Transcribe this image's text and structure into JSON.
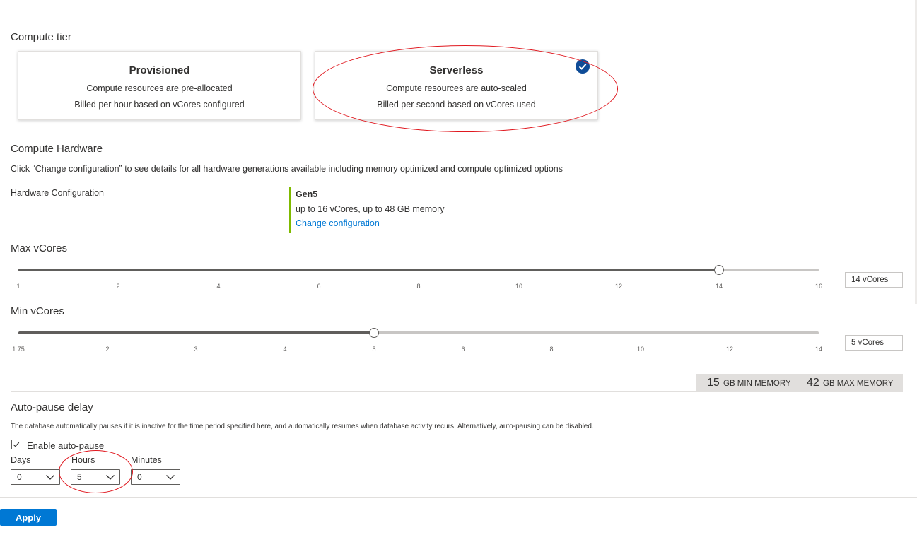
{
  "compute_tier": {
    "title": "Compute tier",
    "provisioned": {
      "title": "Provisioned",
      "line1": "Compute resources are pre-allocated",
      "line2": "Billed per hour based on vCores configured"
    },
    "serverless": {
      "title": "Serverless",
      "line1": "Compute resources are auto-scaled",
      "line2": "Billed per second based on vCores used",
      "selected": true
    }
  },
  "compute_hardware": {
    "title": "Compute Hardware",
    "description": "Click “Change configuration” to see details for all hardware generations available including memory optimized and compute optimized options",
    "config_label": "Hardware Configuration",
    "generation": "Gen5",
    "spec": "up to 16 vCores, up to 48 GB memory",
    "change_link": "Change configuration"
  },
  "max_vcores": {
    "title": "Max vCores",
    "ticks": [
      "1",
      "2",
      "4",
      "6",
      "8",
      "10",
      "12",
      "14",
      "16"
    ],
    "value": 14,
    "value_label": "14 vCores"
  },
  "min_vcores": {
    "title": "Min vCores",
    "ticks": [
      "1.75",
      "2",
      "3",
      "4",
      "5",
      "6",
      "8",
      "10",
      "12",
      "14"
    ],
    "value": 5,
    "value_label": "5 vCores"
  },
  "memory": {
    "min_value": "15",
    "min_label": "GB MIN MEMORY",
    "max_value": "42",
    "max_label": "GB MAX MEMORY"
  },
  "auto_pause": {
    "title": "Auto-pause delay",
    "description": "The database automatically pauses if it is inactive for the time period specified here, and automatically resumes when database activity recurs. Alternatively, auto-pausing can be disabled.",
    "enable_label": "Enable auto-pause",
    "enabled": true,
    "days_label": "Days",
    "days_value": "0",
    "hours_label": "Hours",
    "hours_value": "5",
    "minutes_label": "Minutes",
    "minutes_value": "0"
  },
  "footer": {
    "apply_label": "Apply"
  },
  "colors": {
    "accent": "#0078d4",
    "check_badge": "#0f4c97",
    "highlight_ellipse": "#e0181f",
    "gen_bar": "#7fba00"
  }
}
